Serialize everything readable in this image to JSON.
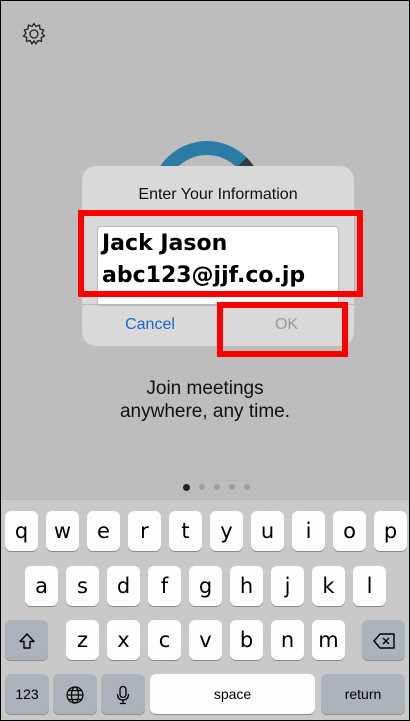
{
  "icons": {
    "settings": "gear-icon",
    "shift": "shift-icon",
    "globe": "globe-icon",
    "mic": "microphone-icon",
    "delete": "delete-icon",
    "logo": "app-logo-ring"
  },
  "dialog": {
    "title": "Enter Your Information",
    "name_value": "Jack Jason",
    "email_value": "abc123@jjf.co.jp",
    "cancel_label": "Cancel",
    "ok_label": "OK"
  },
  "tagline": {
    "line1": "Join meetings",
    "line2": "anywhere, any time."
  },
  "pager": {
    "count": 5,
    "active_index": 0
  },
  "keyboard": {
    "row1": [
      "q",
      "w",
      "e",
      "r",
      "t",
      "y",
      "u",
      "i",
      "o",
      "p"
    ],
    "row2": [
      "a",
      "s",
      "d",
      "f",
      "g",
      "h",
      "j",
      "k",
      "l"
    ],
    "row3": [
      "z",
      "x",
      "c",
      "v",
      "b",
      "n",
      "m"
    ],
    "numbers_label": "123",
    "space_label": "space",
    "return_label": "return"
  },
  "colors": {
    "accent": "#1766c8",
    "highlight": "#ff0000",
    "disabled": "#9b9b9b"
  }
}
